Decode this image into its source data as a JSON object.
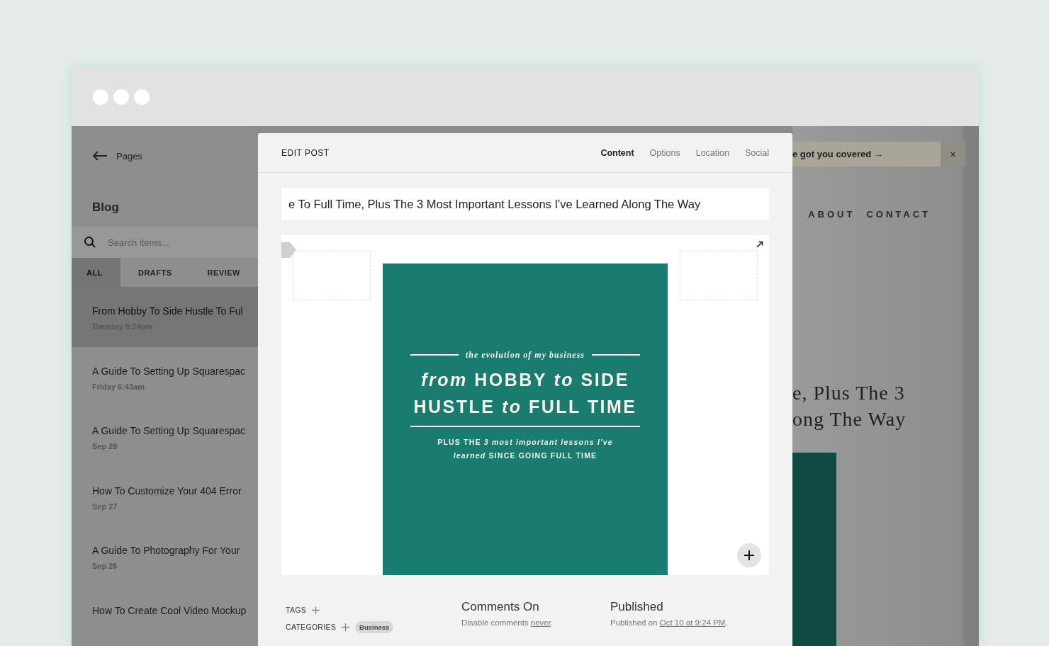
{
  "sidebar": {
    "back_label": "Pages",
    "title": "Blog",
    "search": {
      "placeholder": "Search items..."
    },
    "tabs": [
      {
        "label": "ALL",
        "selected": true
      },
      {
        "label": "DRAFTS",
        "selected": false
      },
      {
        "label": "REVIEW",
        "selected": false
      }
    ],
    "items": [
      {
        "title": "From Hobby To Side Hustle To Ful",
        "date": "Tuesday 9:24pm",
        "selected": true
      },
      {
        "title": "A Guide To Setting Up Squarespac",
        "date": "Friday 6:43am",
        "selected": false
      },
      {
        "title": "A Guide To Setting Up Squarespac",
        "date": "Sep 28",
        "selected": false
      },
      {
        "title": "How To Customize Your 404 Error",
        "date": "Sep 27",
        "selected": false
      },
      {
        "title": "A Guide To Photography For Your",
        "date": "Sep 26",
        "selected": false
      },
      {
        "title": "How To Create Cool Video Mockup",
        "selected": false
      }
    ]
  },
  "modal": {
    "title": "EDIT POST",
    "tabs": [
      {
        "label": "Content",
        "selected": true
      },
      {
        "label": "Options",
        "selected": false
      },
      {
        "label": "Location",
        "selected": false
      },
      {
        "label": "Social",
        "selected": false
      }
    ],
    "post_title": "e To Full Time, Plus The 3 Most Important Lessons I've Learned Along The Way",
    "cover": {
      "kicker": "the evolution of my business",
      "headline": [
        "*from* **HOBBY** *to* **SIDE**",
        "**HUSTLE** *to* **FULL TIME**"
      ],
      "subline": [
        "PLUS THE *3 most important lessons I've*",
        "*learned* SINCE GOING FULL TIME"
      ]
    },
    "tags_label": "TAGS",
    "categories_label": "CATEGORIES",
    "categories": [
      "Business"
    ],
    "comments": {
      "title": "Comments On",
      "text": "Disable comments",
      "link": "never",
      "end": "."
    },
    "published": {
      "title": "Published",
      "text": "Published on",
      "link": "Oct 10 at 9:24 PM",
      "end": "."
    }
  },
  "site": {
    "banner": "e got you covered →",
    "banner_close": "×",
    "nav": [
      "ABOUT",
      "CONTACT"
    ],
    "heading": [
      "e, Plus The 3",
      "ong The Way"
    ]
  }
}
